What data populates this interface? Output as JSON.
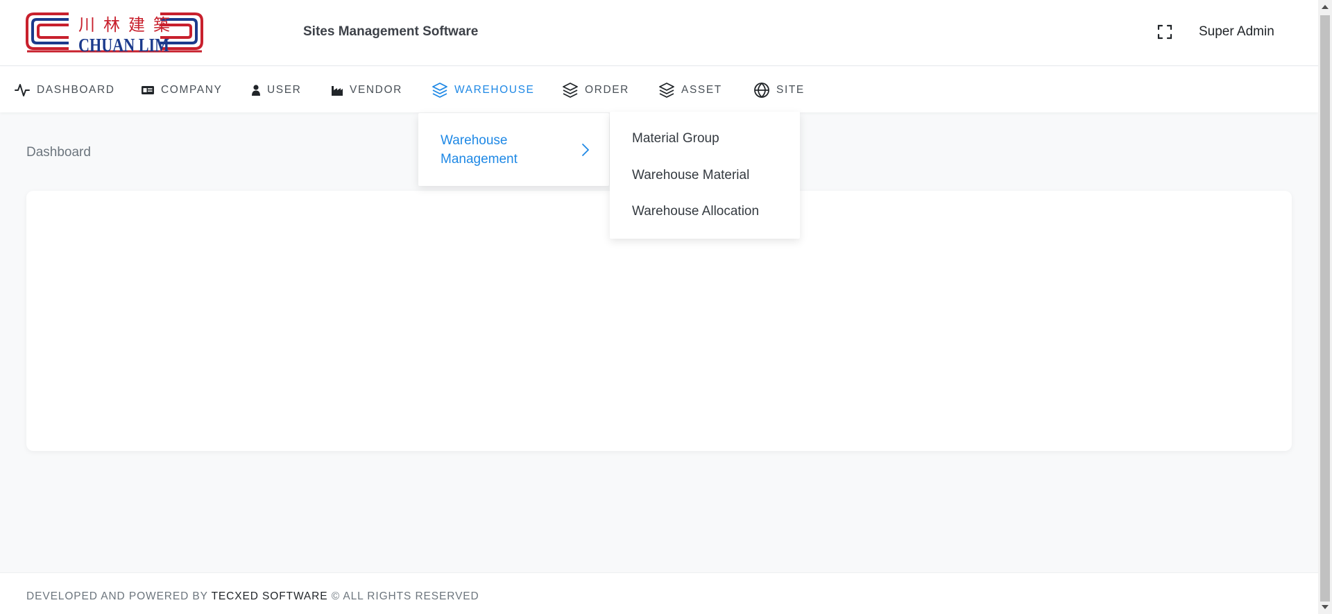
{
  "header": {
    "logo": {
      "chinese": "川林建築",
      "english": "CHUAN LIM",
      "icon": "chuan-lim-logo"
    },
    "app_title": "Sites Management Software",
    "fullscreen_icon": "fullscreen-icon",
    "user_name": "Super Admin"
  },
  "nav": {
    "items": [
      {
        "label": "DASHBOARD",
        "icon": "activity-icon"
      },
      {
        "label": "COMPANY",
        "icon": "id-card-icon"
      },
      {
        "label": "USER",
        "icon": "user-icon"
      },
      {
        "label": "VENDOR",
        "icon": "factory-icon"
      },
      {
        "label": "WAREHOUSE",
        "icon": "layers-icon",
        "active": true
      },
      {
        "label": "ORDER",
        "icon": "layers-icon"
      },
      {
        "label": "ASSET",
        "icon": "layers-icon"
      },
      {
        "label": "SITE",
        "icon": "globe-icon"
      }
    ],
    "active_color": "#1e88e5"
  },
  "dropdown": {
    "item_label": "Warehouse Management",
    "chevron_icon": "chevron-right-icon"
  },
  "submenu": {
    "items": [
      "Material Group",
      "Warehouse Material",
      "Warehouse Allocation"
    ]
  },
  "breadcrumb": "Dashboard",
  "footer": {
    "prefix": "DEVELOPED AND POWERED BY ",
    "brand": "TECXED SOFTWARE",
    "suffix": " © ALL RIGHTS RESERVED"
  }
}
